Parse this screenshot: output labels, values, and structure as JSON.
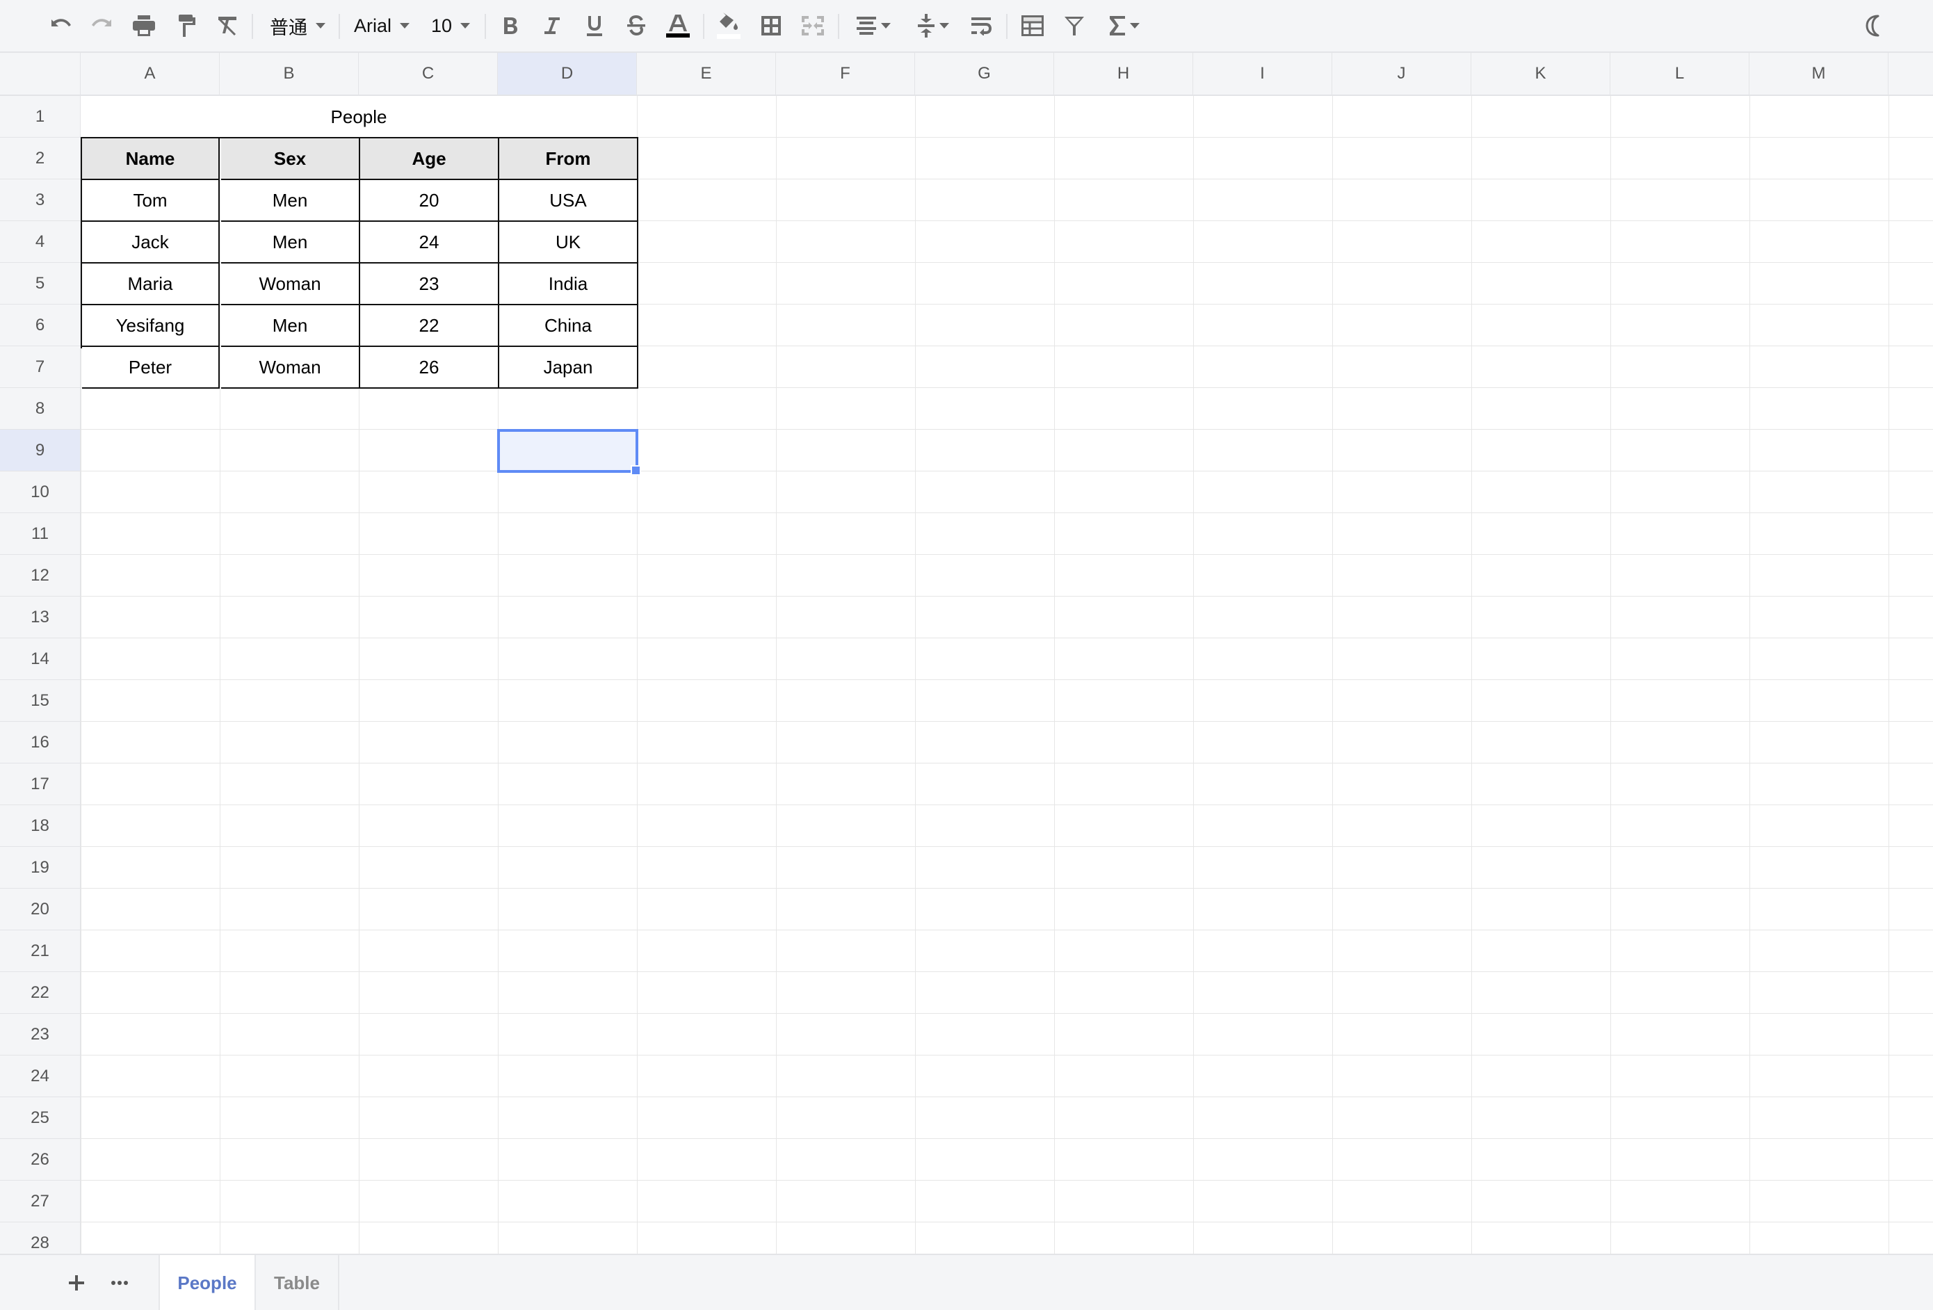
{
  "toolbar": {
    "style_select": "普通",
    "font_select": "Arial",
    "size_select": "10",
    "icons": [
      "undo-icon",
      "redo-icon",
      "print-icon",
      "paint-format-icon",
      "clear-format-icon",
      "bold-icon",
      "italic-icon",
      "underline-icon",
      "strikethrough-icon",
      "text-color-icon",
      "fill-color-icon",
      "borders-icon",
      "merge-cells-icon",
      "horizontal-align-icon",
      "vertical-align-icon",
      "text-wrap-icon",
      "freeze-table-icon",
      "filter-icon",
      "sum-function-icon",
      "dark-mode-moon-icon"
    ],
    "text_color": "#000000",
    "fill_color": "#ffffff"
  },
  "columns": [
    "A",
    "B",
    "C",
    "D",
    "E",
    "F",
    "G",
    "H",
    "I",
    "J",
    "K",
    "L",
    "M",
    ""
  ],
  "rows": [
    "1",
    "2",
    "3",
    "4",
    "5",
    "6",
    "7",
    "8",
    "9",
    "10",
    "11",
    "12",
    "13",
    "14",
    "15",
    "16",
    "17",
    "18",
    "19",
    "20",
    "21",
    "22",
    "23",
    "24",
    "25",
    "26",
    "27",
    "28"
  ],
  "active_cell": {
    "column": "D",
    "row": "9"
  },
  "sheet": {
    "title": "People",
    "headers": [
      "Name",
      "Sex",
      "Age",
      "From"
    ],
    "rows": [
      [
        "Tom",
        "Men",
        "20",
        "USA"
      ],
      [
        "Jack",
        "Men",
        "24",
        "UK"
      ],
      [
        "Maria",
        "Woman",
        "23",
        "India"
      ],
      [
        "Yesifang",
        "Men",
        "22",
        "China"
      ],
      [
        "Peter",
        "Woman",
        "26",
        "Japan"
      ]
    ]
  },
  "tabs": [
    {
      "label": "People",
      "active": true
    },
    {
      "label": "Table",
      "active": false
    }
  ],
  "colors": {
    "selection": "#5f8bf5",
    "selection_fill": "#edf2fd",
    "active_tab": "#5b78c6",
    "header_fill": "#e6e6e6"
  }
}
